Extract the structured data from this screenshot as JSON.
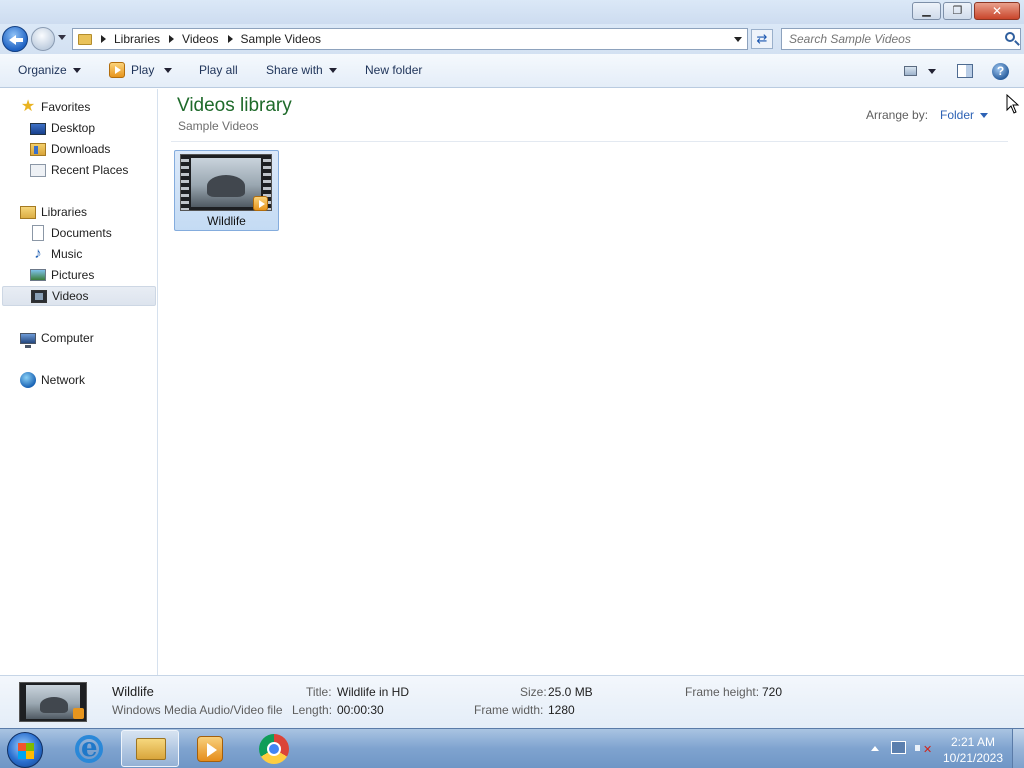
{
  "address": {
    "crumbs": [
      "Libraries",
      "Videos",
      "Sample Videos"
    ]
  },
  "search": {
    "placeholder": "Search Sample Videos"
  },
  "toolbar": {
    "organize": "Organize",
    "play": "Play",
    "play_all": "Play all",
    "share_with": "Share with",
    "new_folder": "New folder"
  },
  "nav": {
    "favorites": "Favorites",
    "desktop": "Desktop",
    "downloads": "Downloads",
    "recent_places": "Recent Places",
    "libraries": "Libraries",
    "documents": "Documents",
    "music": "Music",
    "pictures": "Pictures",
    "videos": "Videos",
    "computer": "Computer",
    "network": "Network"
  },
  "content": {
    "title": "Videos library",
    "subtitle": "Sample Videos",
    "arrange_label": "Arrange by:",
    "arrange_value": "Folder",
    "items": [
      {
        "name": "Wildlife"
      }
    ]
  },
  "details": {
    "name": "Wildlife",
    "type": "Windows Media Audio/Video file",
    "title_label": "Title:",
    "title_value": "Wildlife in HD",
    "length_label": "Length:",
    "length_value": "00:00:30",
    "size_label": "Size:",
    "size_value": "25.0 MB",
    "frame_width_label": "Frame width:",
    "frame_width_value": "1280",
    "frame_height_label": "Frame height:",
    "frame_height_value": "720"
  },
  "taskbar": {
    "time": "2:21 AM",
    "date": "10/21/2023"
  },
  "colors": {
    "library_title": "#1e6a2a",
    "link_blue": "#2d62b5",
    "close_red": "#c9452b"
  }
}
